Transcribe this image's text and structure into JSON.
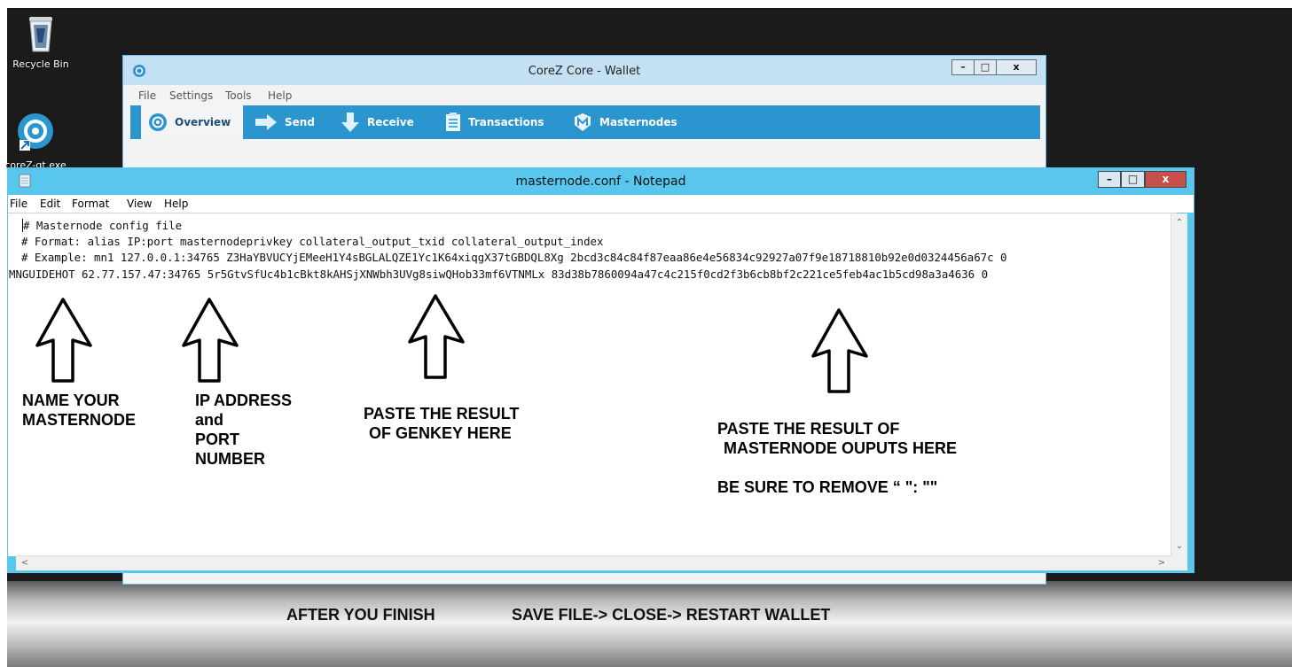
{
  "desktop": {
    "recycle_bin_label": "Recycle Bin",
    "shortcut_label": "coreZ-qt.exe"
  },
  "wallet": {
    "title": "CoreZ Core - Wallet",
    "menu": [
      "File",
      "Settings",
      "Tools",
      "Help"
    ],
    "tabs": [
      {
        "label": "Overview",
        "icon": "overview-icon"
      },
      {
        "label": "Send",
        "icon": "send-arrow-icon"
      },
      {
        "label": "Receive",
        "icon": "receive-arrow-icon"
      },
      {
        "label": "Transactions",
        "icon": "transactions-icon"
      },
      {
        "label": "Masternodes",
        "icon": "masternodes-icon"
      }
    ],
    "active_tab": "Overview",
    "accent_color": "#2a95cf"
  },
  "notepad": {
    "title": "masternode.conf - Notepad",
    "menu": [
      "File",
      "Edit",
      "Format",
      "View",
      "Help"
    ],
    "lines": [
      "# Masternode config file",
      "# Format: alias IP:port masternodeprivkey collateral_output_txid collateral_output_index",
      "# Example: mn1 127.0.0.1:34765 Z3HaYBVUCYjEMeeH1Y4sBGLALQZE1Yc1K64xiqgX37tGBDQL8Xg 2bcd3c84c84f87eaa86e4e56834c92927a07f9e18718810b92e0d0324456a67c 0",
      "MNGUIDEHOT 62.77.157.47:34765 5r5GtvSfUc4b1cBkt8kAHSjXNWbh3UVg8siwQHob33mf6VTNMLx 83d38b7860094a47c4c215f0cd2f3b6cb8bf2c221ce5feb4ac1b5cd98a3a4636 0"
    ],
    "close_color": "#c7504a",
    "title_color": "#58c6ed"
  },
  "annotations": {
    "name": [
      "NAME YOUR",
      "MASTERNODE"
    ],
    "ip": [
      "IP ADDRESS",
      "and",
      "PORT",
      "NUMBER"
    ],
    "genkey": [
      "PASTE THE RESULT",
      "OF GENKEY HERE"
    ],
    "outputs": [
      "PASTE THE RESULT OF",
      "MASTERNODE OUPUTS HERE"
    ],
    "remove": "BE SURE TO REMOVE “ \": \"\""
  },
  "footer": {
    "after": "AFTER YOU FINISH",
    "steps": "SAVE FILE-> CLOSE-> RESTART WALLET"
  }
}
